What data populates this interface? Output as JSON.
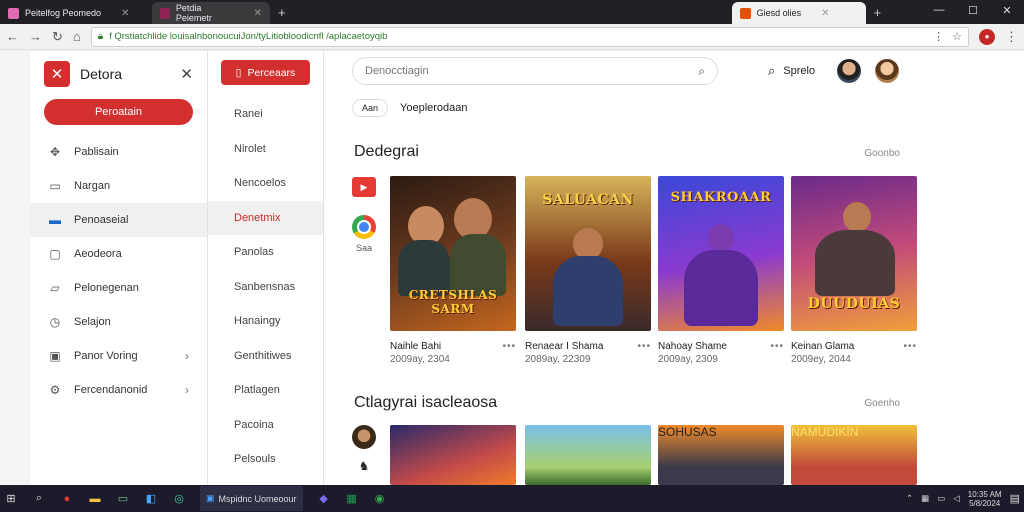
{
  "browser": {
    "tabs": [
      {
        "title": "Peitelfog Peomedo",
        "active": false,
        "favicon_color": "#e06cb2"
      },
      {
        "title": "Petdia Peiemetr",
        "active": true,
        "favicon_color": "#8e2454"
      },
      {
        "title": "Giesd olies",
        "active": true,
        "favicon_color": "#e65100"
      }
    ],
    "new_tab_symbol": "+",
    "window_controls": [
      "—",
      "☐",
      "✕"
    ],
    "url": "f Qrstiatchlide louisalnbonoucuiJon/tyLitiobloodicnfl /aplacaetoyqib",
    "extension_label": "●"
  },
  "drawer": {
    "title": "Detora",
    "primary_button": "Peroatain",
    "items": [
      {
        "label": "Pablisain",
        "icon": "puzzle-icon"
      },
      {
        "label": "Nargan",
        "icon": "bookmark-icon"
      },
      {
        "label": "Penoaseial",
        "icon": "folder-icon",
        "selected": true
      },
      {
        "label": "Aeodeora",
        "icon": "chat-icon"
      },
      {
        "label": "Pelonegenan",
        "icon": "device-icon"
      },
      {
        "label": "Selajon",
        "icon": "clock-icon"
      },
      {
        "label": "Panor Voring",
        "icon": "frame-icon",
        "chevron": true
      },
      {
        "label": "Fercendanonid",
        "icon": "gear-icon",
        "chevron": true
      }
    ]
  },
  "subpanel": {
    "button": "Perceaars",
    "items": [
      {
        "label": "Ranei"
      },
      {
        "label": "Nirolet"
      },
      {
        "label": "Nencoelos"
      },
      {
        "label": "Denetmix",
        "selected": true
      },
      {
        "label": "Panolas"
      },
      {
        "label": "Sanbensnas"
      },
      {
        "label": "Hanaingy"
      },
      {
        "label": "Genthitiwes"
      },
      {
        "label": "Platlagen"
      },
      {
        "label": "Pacoina"
      },
      {
        "label": "Pelsouls"
      }
    ]
  },
  "main": {
    "search_placeholder": "Denocctiagin",
    "header_action": "Sprelo",
    "chip": "Aan",
    "chip_caption": "Yoeplerodaan",
    "section1": {
      "title": "Dedegrai",
      "link": "Goonbo",
      "side_label": "Saa"
    },
    "section2": {
      "title": "Ctlagyrai isacleaosa",
      "link": "Goenho"
    },
    "cards": [
      {
        "art_title": "CRETSHLAS SARM",
        "name": "Naihle Bahi",
        "date": "2009ay, 2304"
      },
      {
        "art_title": "SALUACAN",
        "name": "Renaear I Shama",
        "date": "2089ay, 22309"
      },
      {
        "art_title": "SHAKROAAR",
        "name": "Nahoay Shame",
        "date": "2009ay, 2309"
      },
      {
        "art_title": "DUUDUIAS",
        "name": "Keinan Glama",
        "date": "2009ey, 2044"
      }
    ],
    "cards_row2": [
      {
        "art_title": ""
      },
      {
        "art_title": ""
      },
      {
        "art_title": "SOHUSAS"
      },
      {
        "art_title": "NAMUDIKIN"
      }
    ],
    "dots": "•••"
  },
  "taskbar": {
    "app_label": "Mspidnc Uomeoour",
    "clock_time": "10:35 AM",
    "clock_date": "5/8/2024"
  },
  "colors": {
    "accent": "#d32f2f",
    "link": "#2a7d2a"
  }
}
